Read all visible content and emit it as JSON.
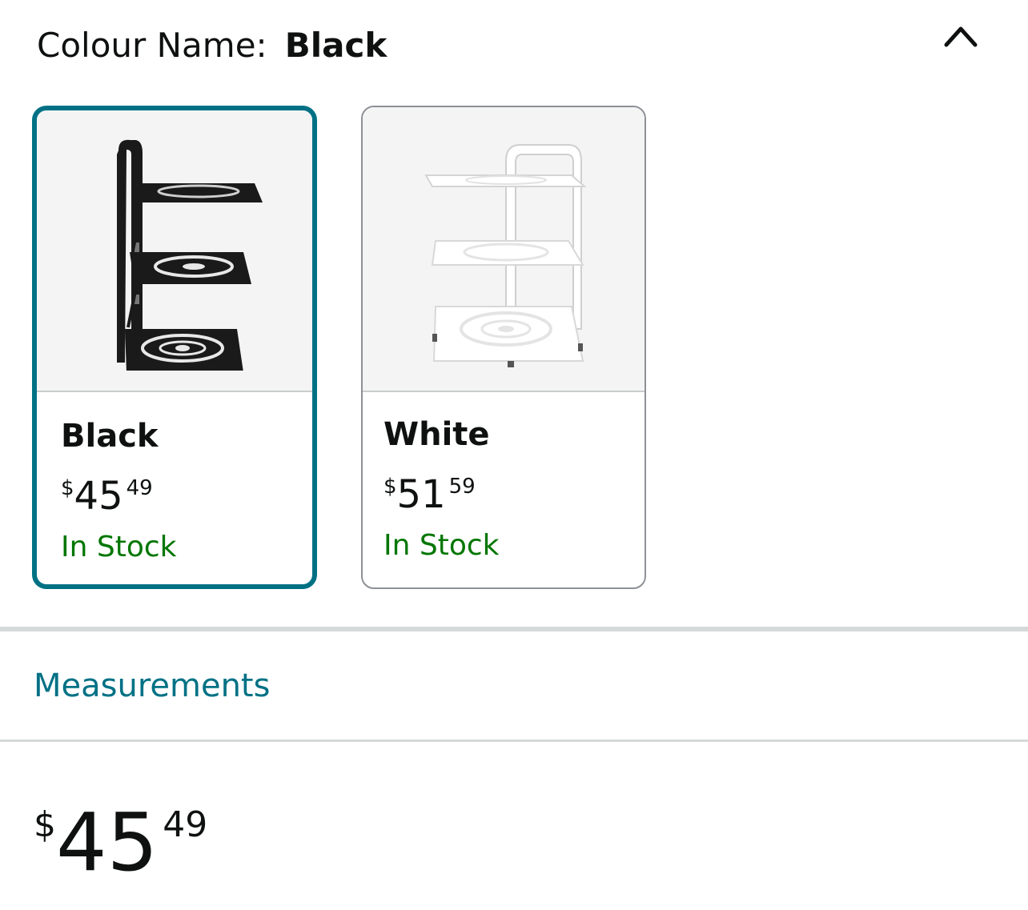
{
  "variation": {
    "label": "Colour Name:",
    "selected_value": "Black",
    "collapse_icon": "chevron-up-icon"
  },
  "swatches": [
    {
      "name": "Black",
      "price": {
        "symbol": "$",
        "whole": "45",
        "fraction": "49"
      },
      "availability": "In Stock",
      "selected": true,
      "product_color": "#1a1a1a"
    },
    {
      "name": "White",
      "price": {
        "symbol": "$",
        "whole": "51",
        "fraction": "59"
      },
      "availability": "In Stock",
      "selected": false,
      "product_color": "#f2f2f2"
    }
  ],
  "measurements": {
    "label": "Measurements"
  },
  "price": {
    "symbol": "$",
    "whole": "45",
    "fraction": "49"
  },
  "colors": {
    "accent": "#007185",
    "in_stock": "#007600",
    "text": "#0f1111",
    "border": "#8d9096"
  }
}
